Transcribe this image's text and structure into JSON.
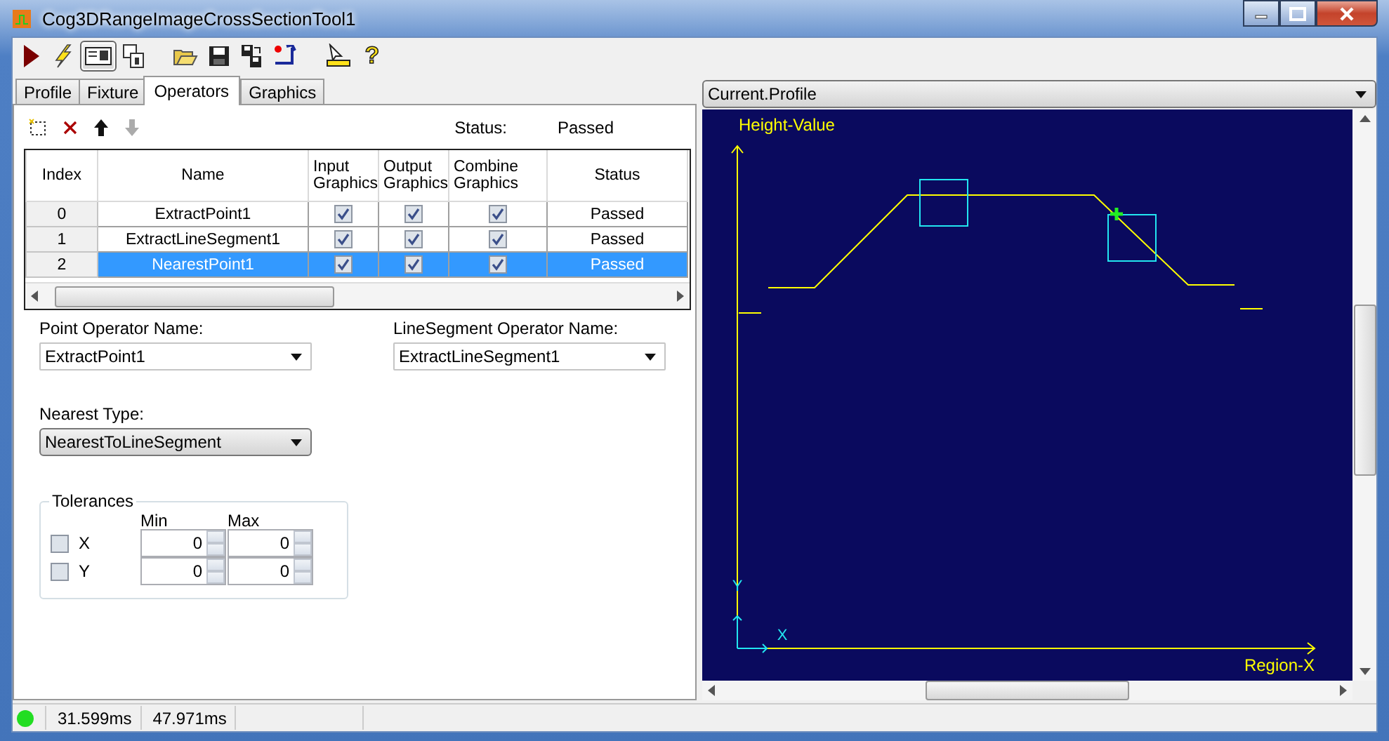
{
  "window": {
    "title": "Cog3DRangeImageCrossSectionTool1"
  },
  "toolbar": [
    {
      "kind": "run",
      "selected": false
    },
    {
      "kind": "live",
      "selected": false
    },
    {
      "kind": "panel",
      "selected": true
    },
    {
      "kind": "float",
      "selected": false
    },
    {
      "kind": "open",
      "selected": false
    },
    {
      "kind": "save",
      "selected": false
    },
    {
      "kind": "copy",
      "selected": false
    },
    {
      "kind": "reset",
      "selected": false
    },
    {
      "kind": "measure",
      "selected": false
    },
    {
      "kind": "help",
      "selected": false,
      "label": "?"
    }
  ],
  "tabs": [
    {
      "label": "Profile",
      "selected": false
    },
    {
      "label": "Fixture",
      "selected": false
    },
    {
      "label": "Operators",
      "selected": true
    },
    {
      "label": "Graphics",
      "selected": false
    }
  ],
  "operator_tools": [
    {
      "kind": "add",
      "disabled": false
    },
    {
      "kind": "delete",
      "disabled": false
    },
    {
      "kind": "up",
      "disabled": false
    },
    {
      "kind": "down",
      "disabled": true
    }
  ],
  "operator_status": {
    "label": "Status:",
    "value": "Passed"
  },
  "table": {
    "columns": [
      "Index",
      "Name",
      "Input Graphics",
      "Output Graphics",
      "Combine Graphics",
      "Status"
    ],
    "rows": [
      {
        "index": "0",
        "name": "ExtractPoint1",
        "input_graphics": true,
        "output_graphics": true,
        "combine_graphics": true,
        "status": "Passed",
        "selected": false
      },
      {
        "index": "1",
        "name": "ExtractLineSegment1",
        "input_graphics": true,
        "output_graphics": true,
        "combine_graphics": true,
        "status": "Passed",
        "selected": false
      },
      {
        "index": "2",
        "name": "NearestPoint1",
        "input_graphics": true,
        "output_graphics": true,
        "combine_graphics": true,
        "status": "Passed",
        "selected": true
      }
    ]
  },
  "point_operator": {
    "label": "Point Operator Name:",
    "value": "ExtractPoint1"
  },
  "line_segment_operator": {
    "label": "LineSegment Operator Name:",
    "value": "ExtractLineSegment1"
  },
  "nearest_type": {
    "label": "Nearest Type:",
    "value": "NearestToLineSegment"
  },
  "tolerances": {
    "title": "Tolerances",
    "min_label": "Min",
    "max_label": "Max",
    "rows": [
      {
        "label": "X",
        "checked": false,
        "min": "0",
        "max": "0"
      },
      {
        "label": "Y",
        "checked": false,
        "min": "0",
        "max": "0"
      }
    ]
  },
  "display": {
    "source": "Current.Profile",
    "y_label": "Height-Value",
    "x_label": "Region-X",
    "origin_x": "X",
    "origin_y": "Y"
  },
  "status_bar": {
    "passed": true,
    "times": [
      "31.599ms",
      "47.971ms"
    ]
  }
}
